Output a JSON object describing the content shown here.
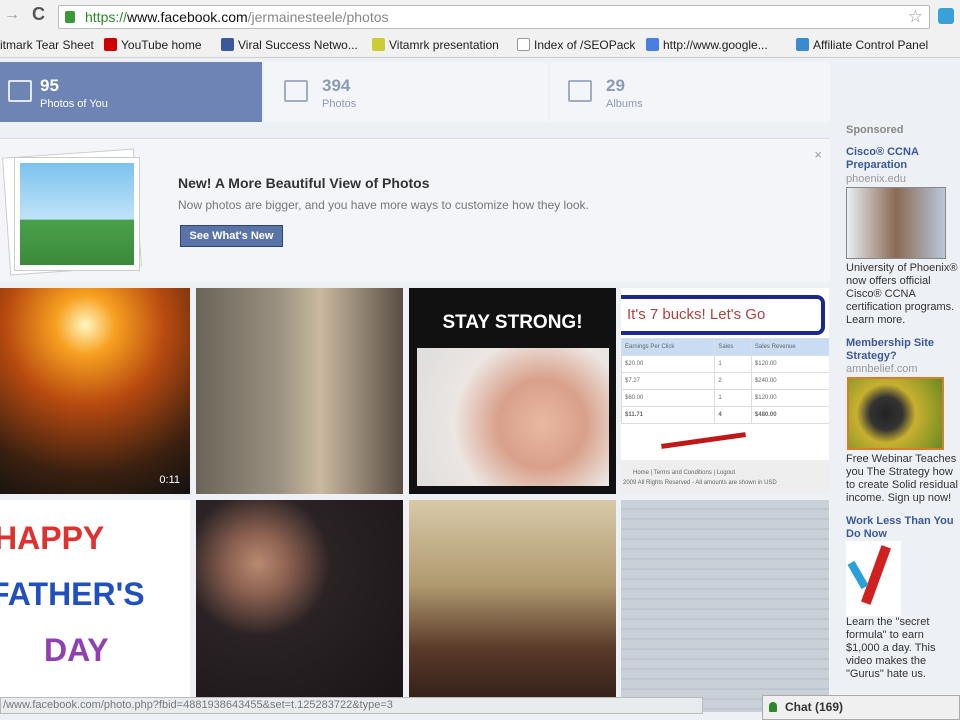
{
  "browser": {
    "url_https": "https://",
    "url_domain": "www.facebook.com",
    "url_path": "/jermainesteele/photos",
    "bookmarks": [
      "itmark Tear Sheet",
      "YouTube home",
      "Viral Success Netwo...",
      "Vitamrk presentation",
      "Index of /SEOPack",
      "http://www.google...",
      "Affiliate Control Panel"
    ],
    "status_url": "/www.facebook.com/photo.php?fbid=4881938643455&set=t.125283722&type=3"
  },
  "tabs": [
    {
      "count": "95",
      "label": "Photos of You"
    },
    {
      "count": "394",
      "label": "Photos"
    },
    {
      "count": "29",
      "label": "Albums"
    }
  ],
  "banner": {
    "headline": "New! A More Beautiful View of Photos",
    "subline": "Now photos are bigger, and you have more ways to customize how they look.",
    "button": "See What's New",
    "close": "×"
  },
  "photos": {
    "video_duration": "0:11",
    "stay_strong": "STAY STRONG!",
    "bucks": "It's 7 bucks! Let's Go",
    "table_headers": [
      "Earnings Per Click",
      "Sales",
      "Sales Revenue"
    ],
    "table_rows": [
      [
        "$20.00",
        "1",
        "$120.00"
      ],
      [
        "$7.27",
        "2",
        "$240.00"
      ],
      [
        "$60.00",
        "1",
        "$120.00"
      ],
      [
        "$11.71",
        "4",
        "$480.00"
      ]
    ],
    "footer_links": "Home | Terms and Conditions | Logout",
    "footer_note": "2009 All Rights Reserved - All amounts are shown in USD",
    "fathers_day": [
      "HAPPY",
      "FATHER'S",
      "DAY"
    ]
  },
  "sidebar": {
    "sponsored": "Sponsored",
    "ads": [
      {
        "title": "Cisco® CCNA Preparation",
        "domain": "phoenix.edu",
        "body": "University of Phoenix® now offers official Cisco® CCNA certification programs. Learn more."
      },
      {
        "title": "Membership Site Strategy?",
        "domain": "amnbelief.com",
        "body": "Free Webinar Teaches you The Strategy how to create Solid residual income. Sign up now!"
      },
      {
        "title": "Work Less Than You Do Now",
        "body": "Learn the \"secret formula\" to earn $1,000 a day. This video makes the \"Gurus\" hate us."
      }
    ]
  },
  "chat": {
    "label": "Chat (169)"
  }
}
